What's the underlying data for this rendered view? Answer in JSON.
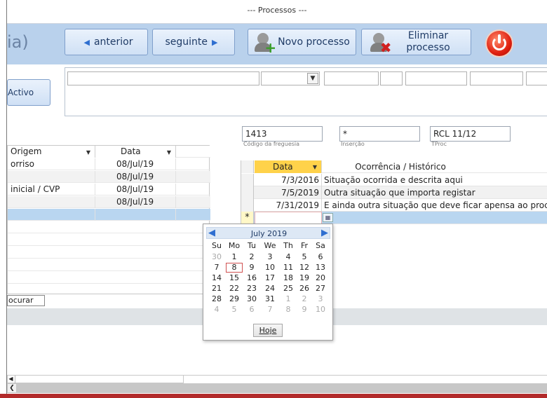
{
  "window": {
    "title": "--- Processos ---"
  },
  "header": {
    "app_name": "ia)",
    "buttons": {
      "prev": "anterior",
      "next": "seguinte",
      "new": "Novo processo",
      "delete_line1": "Eliminar",
      "delete_line2": "processo"
    },
    "icons": {
      "prev": "triangle-left-icon",
      "next": "triangle-right-icon",
      "new": "person-add-icon",
      "delete": "person-delete-icon",
      "power": "power-icon"
    },
    "accent": "#b9d1ec"
  },
  "filters": {
    "activo_label": "Activo"
  },
  "left_list": {
    "headers": [
      "Origem",
      "Data"
    ],
    "rows": [
      {
        "origem": "orriso",
        "data": "08/Jul/19"
      },
      {
        "origem": "",
        "data": "08/Jul/19"
      },
      {
        "origem": "inicial / CVP",
        "data": "08/Jul/19"
      },
      {
        "origem": "",
        "data": "08/Jul/19"
      },
      {
        "origem": "",
        "data": ""
      }
    ],
    "search_label": "ocurar"
  },
  "fields": {
    "codigo": {
      "value": "1413",
      "label": "Código da freguesia"
    },
    "insercao": {
      "value": "*",
      "label": "Inserção"
    },
    "proc": {
      "value": "RCL 11/12",
      "label": "TProc"
    }
  },
  "history": {
    "headers": [
      "Data",
      "Ocorrência / Histórico"
    ],
    "rows": [
      {
        "date": "7/3/2016",
        "text": "Situação ocorrida e descrita aqui"
      },
      {
        "date": "7/5/2019",
        "text": "Outra situação que importa registar"
      },
      {
        "date": "7/31/2019",
        "text": "E ainda outra situação que deve ficar apensa ao process"
      }
    ],
    "new_row_marker": "*"
  },
  "calendar": {
    "month": "July 2019",
    "days_of_week": [
      "Su",
      "Mo",
      "Tu",
      "We",
      "Th",
      "Fr",
      "Sa"
    ],
    "weeks": [
      [
        "30",
        "1",
        "2",
        "3",
        "4",
        "5",
        "6"
      ],
      [
        "7",
        "8",
        "9",
        "10",
        "11",
        "12",
        "13"
      ],
      [
        "14",
        "15",
        "16",
        "17",
        "18",
        "19",
        "20"
      ],
      [
        "21",
        "22",
        "23",
        "24",
        "25",
        "26",
        "27"
      ],
      [
        "28",
        "29",
        "30",
        "31",
        "1",
        "2",
        "3"
      ],
      [
        "4",
        "5",
        "6",
        "7",
        "8",
        "9",
        "10"
      ]
    ],
    "selected_day": "8",
    "today_button": "Hoje"
  }
}
